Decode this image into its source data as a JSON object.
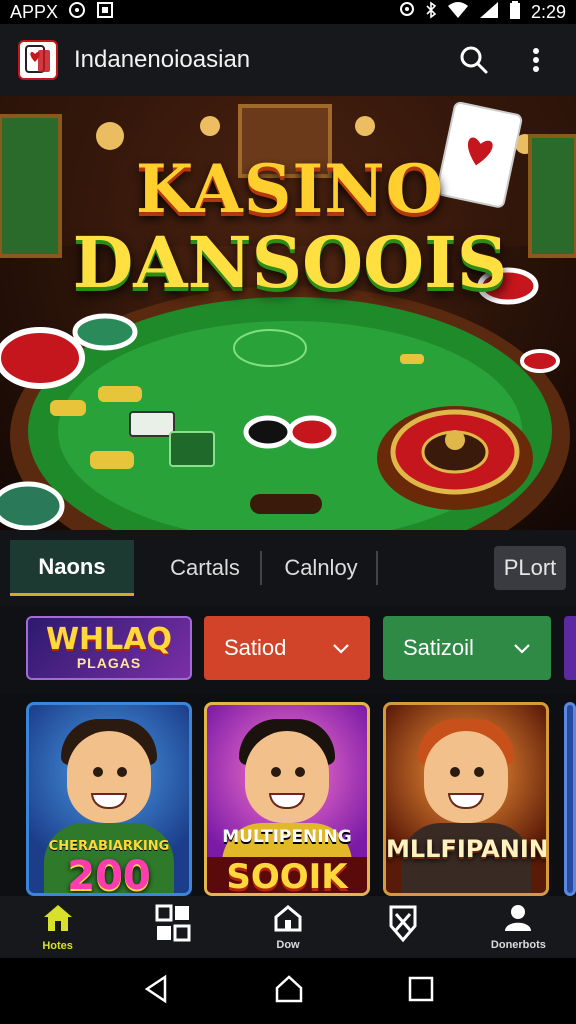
{
  "status_bar": {
    "left_text": "APPX",
    "time": "2:29",
    "icons": [
      "notification-icon",
      "sim-icon",
      "location-icon",
      "bluetooth-icon",
      "wifi-icon",
      "signal-icon",
      "battery-icon"
    ]
  },
  "app_bar": {
    "title": "Indanenoioasian",
    "icons": [
      "card-logo-icon",
      "search-icon",
      "more-vert-icon"
    ]
  },
  "banner": {
    "title_line1": "KASINO",
    "title_line2": "DANSOOIS"
  },
  "tabs": {
    "items": [
      {
        "label": "Naons",
        "active": true
      },
      {
        "label": "Cartals",
        "active": false
      },
      {
        "label": "Calnloy",
        "active": false
      }
    ],
    "play_label": "PLort"
  },
  "filters": {
    "promo_line1": "WHLAQ",
    "promo_line2": "PLAGAS",
    "select1": {
      "value": "Satiod",
      "color": "#d2442a"
    },
    "select2": {
      "value": "Satizoil",
      "color": "#2e8a45"
    }
  },
  "games": [
    {
      "line1": "CHERABIARKING",
      "line2": "200"
    },
    {
      "line1": "MULTIPENING",
      "line2": "SOOIK"
    },
    {
      "line1": "MLLFIPANIN",
      "line2": ""
    }
  ],
  "bottom_nav": {
    "items": [
      {
        "label": "Hotes",
        "icon": "home-icon",
        "active": true
      },
      {
        "label": "",
        "icon": "grid-icon",
        "active": false
      },
      {
        "label": "Dow",
        "icon": "house-outline-icon",
        "active": false
      },
      {
        "label": "",
        "icon": "shield-x-icon",
        "active": false
      },
      {
        "label": "Donerbots",
        "icon": "person-icon",
        "active": false
      }
    ]
  },
  "colors": {
    "accent_gold": "#d4a82a",
    "active_nav": "#d7e02a"
  }
}
